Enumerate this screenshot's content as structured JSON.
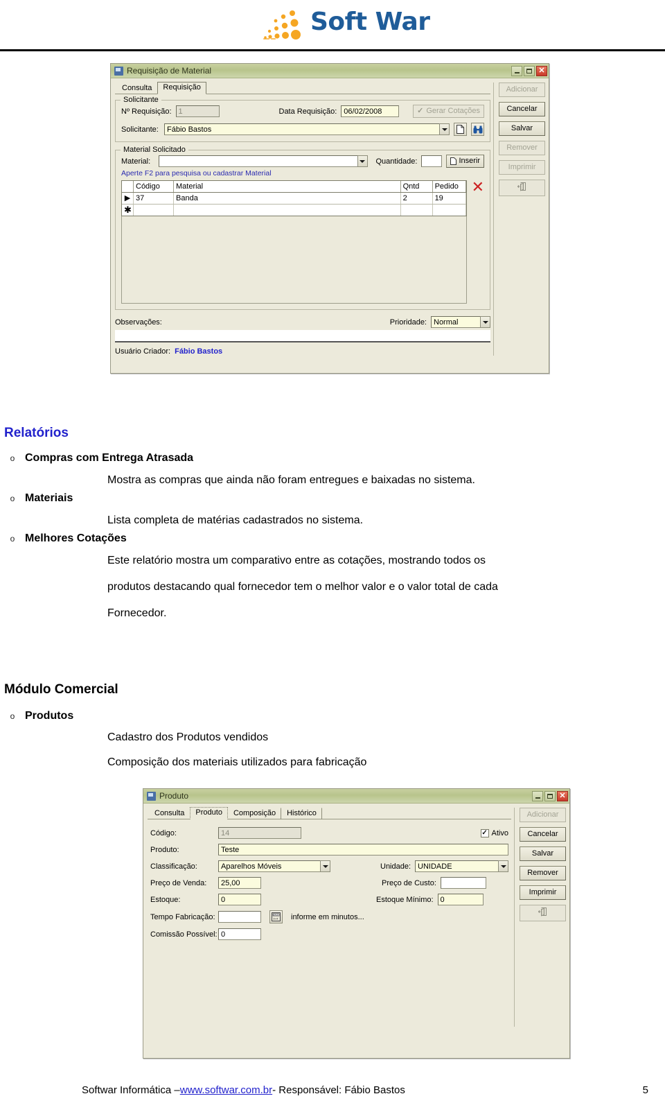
{
  "header": {
    "logo_text": "Soft War",
    "logo_colors": {
      "text": "#1F5C99",
      "dots": "#F5A623"
    }
  },
  "dialog1": {
    "title": "Requisição de Material",
    "titlebar_buttons": [
      "minimize",
      "maximize",
      "close"
    ],
    "tabs": [
      {
        "label": "Consulta",
        "active": false
      },
      {
        "label": "Requisição",
        "active": true
      }
    ],
    "group_solicitante": {
      "title": "Solicitante",
      "num_requisicao_label": "Nº Requisição:",
      "num_requisicao_value": "1",
      "data_requisicao_label": "Data Requisição:",
      "data_requisicao_value": "06/02/2008",
      "gerar_cotacoes_label": "Gerar Cotações",
      "gerar_cotacoes_checked": true,
      "gerar_cotacoes_enabled": false,
      "solicitante_label": "Solicitante:",
      "solicitante_value": "Fábio Bastos"
    },
    "group_material": {
      "title": "Material Solicitado",
      "material_label": "Material:",
      "material_value": "",
      "quantidade_label": "Quantidade:",
      "quantidade_value": "",
      "inserir_label": "Inserir",
      "hint": "Aperte F2 para pesquisa ou cadastrar Material",
      "grid": {
        "columns": [
          "",
          "Código",
          "Material",
          "Qntd",
          "Pedido"
        ],
        "rows": [
          {
            "mark": "▶",
            "codigo": "37",
            "material": "Banda",
            "qntd": "2",
            "pedido": "19"
          },
          {
            "mark": "✱",
            "codigo": "",
            "material": "",
            "qntd": "",
            "pedido": ""
          }
        ]
      },
      "delete_icon": "✕"
    },
    "observacoes_label": "Observações:",
    "observacoes_value": "",
    "prioridade_label": "Prioridade:",
    "prioridade_value": "Normal",
    "usuario_criador_label": "Usuário Criador:",
    "usuario_criador_value": "Fábio Bastos",
    "buttons": [
      {
        "label": "Adicionar",
        "accesskey": "A",
        "enabled": false
      },
      {
        "label": "Cancelar",
        "accesskey": "C",
        "enabled": true
      },
      {
        "label": "Salvar",
        "accesskey": "S",
        "enabled": true
      },
      {
        "label": "Remover",
        "accesskey": "R",
        "enabled": false
      },
      {
        "label": "Imprimir",
        "accesskey": "I",
        "enabled": false
      },
      {
        "label": "",
        "icon": "exit-icon",
        "enabled": false
      }
    ]
  },
  "section_relatorios": {
    "heading": "Relatórios",
    "items": [
      {
        "title": "Compras com Entrega Atrasada",
        "lines": [
          "Mostra as compras que ainda não foram entregues e baixadas no sistema."
        ]
      },
      {
        "title": "Materiais",
        "lines": [
          "Lista completa de matérias cadastrados no sistema."
        ]
      },
      {
        "title": "Melhores Cotações",
        "lines": [
          "Este relatório mostra um comparativo entre as cotações, mostrando todos os",
          "produtos destacando qual fornecedor tem o melhor valor e o valor total de cada",
          "Fornecedor."
        ]
      }
    ]
  },
  "section_comercial": {
    "heading": "Módulo Comercial",
    "items": [
      {
        "title": "Produtos",
        "lines": [
          "Cadastro dos Produtos vendidos",
          "Composição dos materiais utilizados para fabricação"
        ]
      }
    ]
  },
  "dialog2": {
    "title": "Produto",
    "tabs": [
      {
        "label": "Consulta",
        "active": false
      },
      {
        "label": "Produto",
        "active": true
      },
      {
        "label": "Composição",
        "active": false
      },
      {
        "label": "Histórico",
        "active": false
      }
    ],
    "fields": {
      "codigo_label": "Código:",
      "codigo_value": "14",
      "ativo_label": "Ativo",
      "ativo_checked": true,
      "produto_label": "Produto:",
      "produto_value": "Teste",
      "classificacao_label": "Classificação:",
      "classificacao_value": "Aparelhos Móveis",
      "unidade_label": "Unidade:",
      "unidade_value": "UNIDADE",
      "preco_venda_label": "Preço de Venda:",
      "preco_venda_value": "25,00",
      "preco_custo_label": "Preço de Custo:",
      "preco_custo_value": "",
      "estoque_label": "Estoque:",
      "estoque_value": "0",
      "estoque_minimo_label": "Estoque Mínimo:",
      "estoque_minimo_value": "0",
      "tempo_fabricacao_label": "Tempo Fabricação:",
      "tempo_fabricacao_value": "",
      "tempo_fabricacao_hint": "informe em minutos...",
      "comissao_label": "Comissão Possível:",
      "comissao_value": "0"
    },
    "buttons": [
      {
        "label": "Adicionar",
        "accesskey": "A",
        "enabled": false
      },
      {
        "label": "Cancelar",
        "accesskey": "C",
        "enabled": true
      },
      {
        "label": "Salvar",
        "accesskey": "S",
        "enabled": true
      },
      {
        "label": "Remover",
        "accesskey": "R",
        "enabled": true
      },
      {
        "label": "Imprimir",
        "accesskey": "I",
        "enabled": true
      },
      {
        "label": "",
        "icon": "exit-icon",
        "enabled": false
      }
    ]
  },
  "footer": {
    "prefix": "Softwar Informática – ",
    "link": "www.softwar.com.br",
    "suffix": " - Responsável: Fábio Bastos",
    "page_number": "5"
  }
}
